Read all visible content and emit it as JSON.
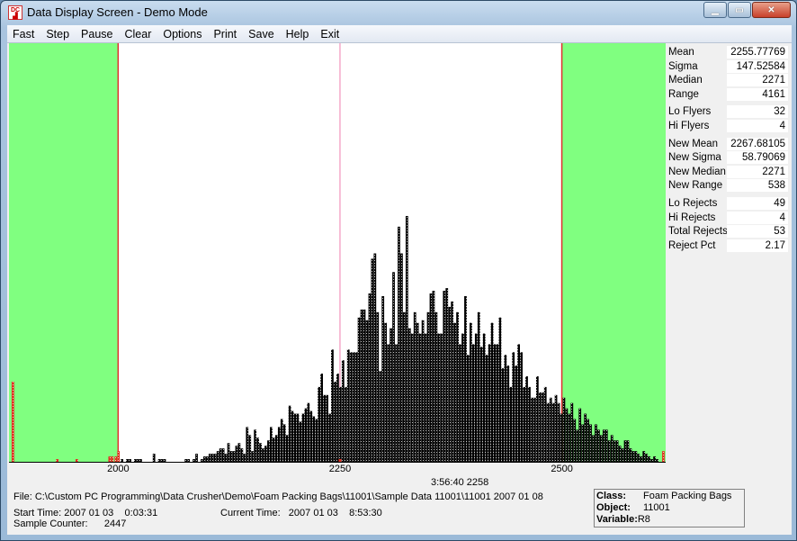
{
  "window": {
    "title": "Data Display Screen - Demo Mode",
    "icon": "dc-app-icon",
    "controls": [
      "minimize",
      "maximize",
      "close"
    ]
  },
  "menu": [
    {
      "label": "Fast"
    },
    {
      "label": "Step"
    },
    {
      "label": "Pause"
    },
    {
      "label": "Clear"
    },
    {
      "label": "Options"
    },
    {
      "label": "Print"
    },
    {
      "label": "Save"
    },
    {
      "label": "Help"
    },
    {
      "label": "Exit"
    }
  ],
  "colors": {
    "reject_zone": "#80ff80",
    "limit_line": "#e03030",
    "mean_line": "#f080b0",
    "bar": "#000000",
    "reject_bar": "#e03020"
  },
  "stats": {
    "groups": [
      [
        {
          "label": "Mean",
          "value": "2255.77769"
        },
        {
          "label": "Sigma",
          "value": "147.52584"
        },
        {
          "label": "Median",
          "value": "2271"
        },
        {
          "label": "Range",
          "value": "4161"
        }
      ],
      [
        {
          "label": "Lo Flyers",
          "value": "32"
        },
        {
          "label": "Hi Flyers",
          "value": "4"
        }
      ],
      [
        {
          "label": "New Mean",
          "value": "2267.68105"
        },
        {
          "label": "New Sigma",
          "value": "58.79069"
        },
        {
          "label": "New Median",
          "value": "2271"
        },
        {
          "label": "New Range",
          "value": "538"
        }
      ],
      [
        {
          "label": "Lo Rejects",
          "value": "49"
        },
        {
          "label": "Hi Rejects",
          "value": "4"
        },
        {
          "label": "Total Rejects",
          "value": "53"
        },
        {
          "label": "Reject Pct",
          "value": "2.17"
        }
      ]
    ]
  },
  "cursor_readout": "3:56:40  2258",
  "footer": {
    "file": "File: C:\\Custom PC Programming\\Data Crusher\\Demo\\Foam Packing Bags\\11001\\Sample Data 11001\\11001 2007 01 08",
    "start_time": "Start Time: 2007 01 03    0:03:31",
    "current_time": "Current Time:   2007 01 03    8:53:30",
    "sample_counter": "Sample Counter:      2447"
  },
  "info": {
    "class_label": "Class:",
    "class_value": "Foam Packing Bags",
    "object_label": "Object:",
    "object_value": "11001",
    "variable_label": "Variable:",
    "variable_value": "R8"
  },
  "chart_data": {
    "type": "bar",
    "title": "",
    "xlabel": "",
    "ylabel": "",
    "x_ticks": [
      2000,
      2250,
      2500
    ],
    "xlim": [
      1877,
      2617
    ],
    "ylim": [
      0,
      155
    ],
    "lower_limit": 2000,
    "upper_limit": 2500,
    "mean_marker": 2250,
    "bin_width": 3,
    "bin_start": 2003,
    "counts": [
      1,
      0,
      1,
      1,
      0,
      1,
      1,
      1,
      0,
      0,
      0,
      0,
      3,
      0,
      1,
      1,
      1,
      0,
      0,
      0,
      0,
      0,
      0,
      0,
      1,
      1,
      0,
      1,
      3,
      0,
      1,
      2,
      2,
      3,
      3,
      3,
      4,
      5,
      5,
      3,
      7,
      4,
      4,
      6,
      7,
      5,
      3,
      13,
      10,
      4,
      12,
      9,
      7,
      5,
      6,
      8,
      13,
      9,
      10,
      13,
      16,
      14,
      10,
      21,
      19,
      18,
      18,
      15,
      18,
      20,
      22,
      19,
      17,
      16,
      28,
      33,
      25,
      25,
      18,
      42,
      30,
      33,
      28,
      38,
      28,
      42,
      41,
      41,
      41,
      54,
      57,
      57,
      53,
      63,
      76,
      78,
      56,
      34,
      62,
      52,
      44,
      50,
      71,
      44,
      88,
      78,
      56,
      92,
      50,
      48,
      56,
      52,
      48,
      53,
      48,
      56,
      63,
      64,
      56,
      48,
      48,
      64,
      65,
      58,
      60,
      52,
      56,
      44,
      48,
      62,
      40,
      52,
      44,
      48,
      56,
      43,
      48,
      40,
      44,
      52,
      44,
      44,
      54,
      35,
      40,
      36,
      28,
      41,
      36,
      44,
      41,
      28,
      32,
      28,
      24,
      24,
      32,
      26,
      26,
      28,
      22,
      24,
      22,
      25,
      22,
      18,
      24,
      20,
      18,
      22,
      16,
      12,
      20,
      14,
      18,
      16,
      14,
      10,
      14,
      12,
      10,
      12,
      12,
      8,
      10,
      8,
      8,
      6,
      5,
      8,
      8,
      5,
      4,
      4,
      3,
      2,
      4,
      3,
      2,
      1,
      2,
      1
    ],
    "lo_flyer_bins": [
      {
        "x": 1880,
        "count": 30
      },
      {
        "x": 1930,
        "count": 1
      },
      {
        "x": 1952,
        "count": 1
      },
      {
        "x": 1989,
        "count": 2
      },
      {
        "x": 1992,
        "count": 2
      },
      {
        "x": 1996,
        "count": 2
      },
      {
        "x": 1999,
        "count": 4
      }
    ],
    "hi_flyer_bins": [
      {
        "x": 2613,
        "count": 4
      }
    ]
  }
}
